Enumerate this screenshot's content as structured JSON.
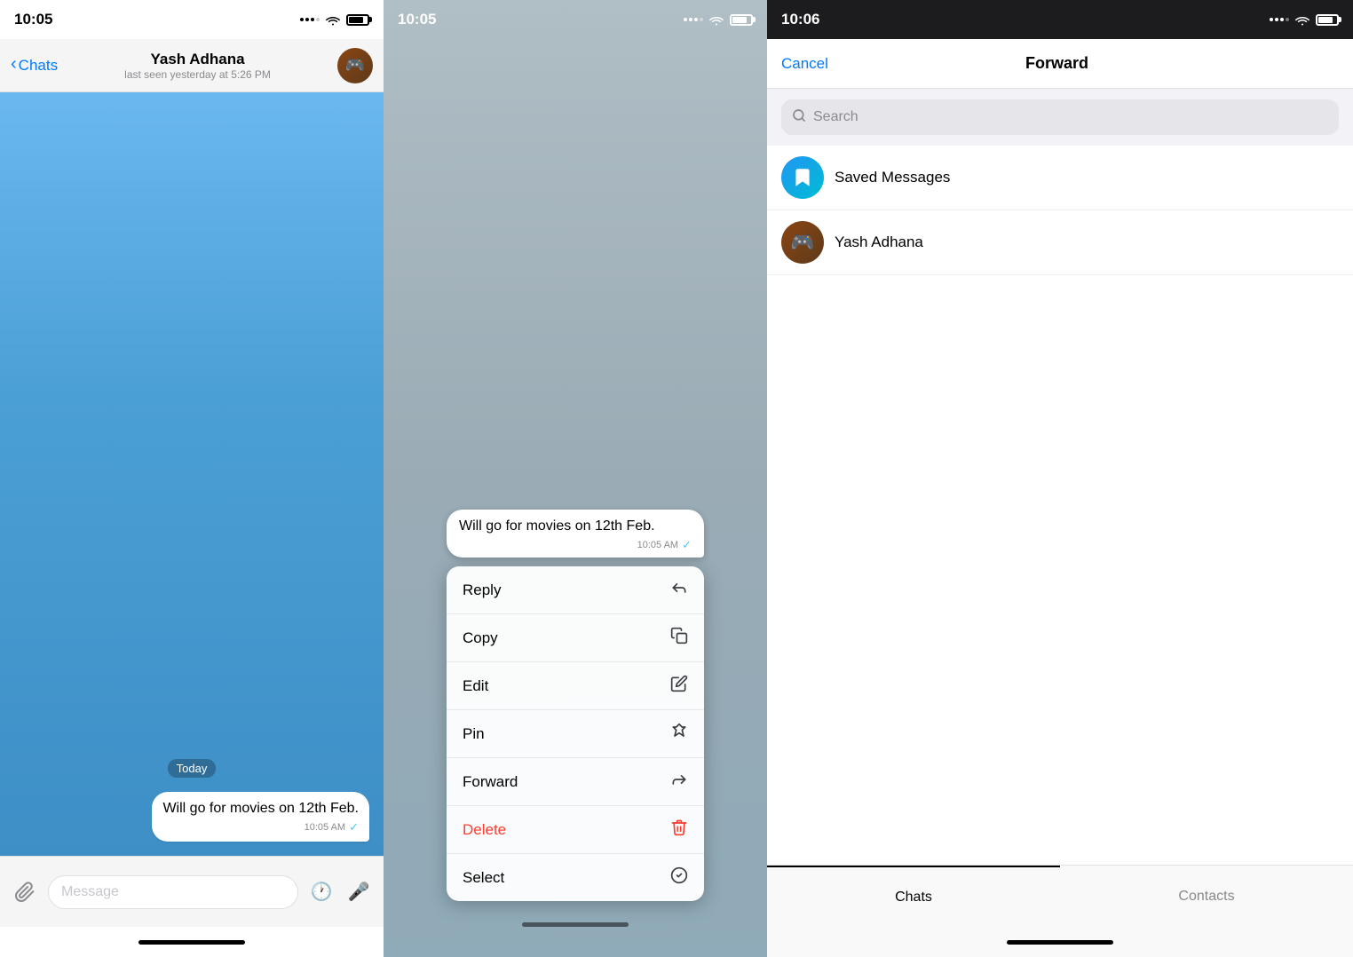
{
  "panel1": {
    "status_bar": {
      "time": "10:05"
    },
    "header": {
      "back_label": "Chats",
      "contact_name": "Yash Adhana",
      "contact_status": "last seen yesterday at 5:26 PM"
    },
    "messages": {
      "date_divider": "Today",
      "bubble": {
        "text": "Will go for movies on 12th Feb.",
        "time": "10:05 AM",
        "tick": "✓"
      }
    },
    "input": {
      "placeholder": "Message"
    }
  },
  "panel2": {
    "message": {
      "text": "Will go for movies on 12th Feb.",
      "time": "10:05 AM",
      "tick": "✓"
    },
    "menu_items": [
      {
        "label": "Reply",
        "icon": "reply"
      },
      {
        "label": "Copy",
        "icon": "copy"
      },
      {
        "label": "Edit",
        "icon": "edit"
      },
      {
        "label": "Pin",
        "icon": "pin"
      },
      {
        "label": "Forward",
        "icon": "forward"
      },
      {
        "label": "Delete",
        "icon": "trash",
        "danger": true
      },
      {
        "label": "Select",
        "icon": "select"
      }
    ]
  },
  "panel3": {
    "status_bar": {
      "time": "10:06"
    },
    "header": {
      "cancel_label": "Cancel",
      "title": "Forward"
    },
    "search": {
      "placeholder": "Search"
    },
    "contacts": [
      {
        "name": "Saved Messages",
        "type": "saved"
      },
      {
        "name": "Yash Adhana",
        "type": "user"
      }
    ],
    "tabs": [
      {
        "label": "Chats",
        "active": true
      },
      {
        "label": "Contacts",
        "active": false
      }
    ]
  }
}
